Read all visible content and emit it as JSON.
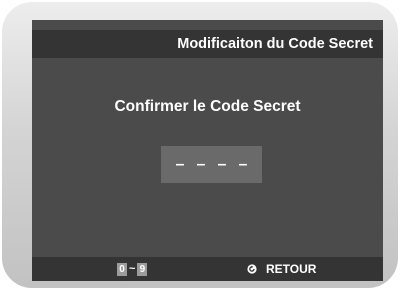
{
  "dialog": {
    "title": "Modificaiton du Code Secret",
    "prompt": "Confirmer le Code Secret",
    "code_slots": [
      "–",
      "–",
      "–",
      "–"
    ]
  },
  "footer": {
    "range_from": "0",
    "range_sep": "~",
    "range_to": "9",
    "return_label": "RETOUR",
    "return_icon": "return-arrow-icon"
  },
  "colors": {
    "screen_bg": "#4b4b4b",
    "bar_bg": "#343434",
    "code_box_bg": "#6a6a6a",
    "text": "#ffffff"
  }
}
